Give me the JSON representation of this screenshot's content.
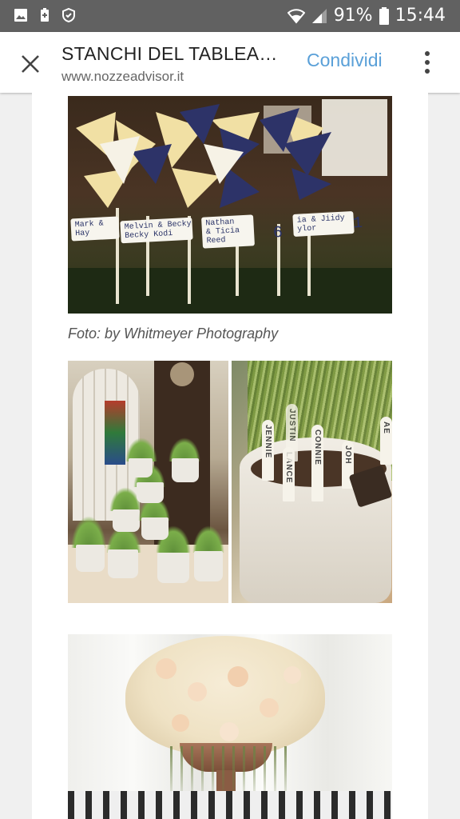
{
  "status_bar": {
    "battery_percent": "91%",
    "time": "15:44",
    "icons": [
      "gallery-icon",
      "battery-saver-icon",
      "shield-icon",
      "wifi-icon",
      "signal-icon",
      "battery-icon"
    ]
  },
  "app_bar": {
    "title": "STANCHI DEL TABLEA…",
    "url": "www.nozzeadvisor.it",
    "share_label": "Condividi",
    "close_icon": "close-icon",
    "more_icon": "more-vert-icon"
  },
  "article": {
    "photo1_caption": "Foto: by Whitmeyer Photography",
    "pinwheel_cards": [
      {
        "text": "Mark & \nHay"
      },
      {
        "text": "Melvin & Becky\nBecky Kodi"
      },
      {
        "text": "Nathan\n& Ticia\nReed"
      },
      {
        "text": "6"
      },
      {
        "text": "ia & Jiidy\nylor"
      },
      {
        "text": "1"
      }
    ],
    "herb_tags": [
      "JENNIE",
      "LANCE",
      "CONNIE",
      "JOH",
      "JUSTIN",
      "AE"
    ]
  },
  "colors": {
    "share_accent": "#5aa0d8",
    "status_bar_bg": "#616161"
  }
}
